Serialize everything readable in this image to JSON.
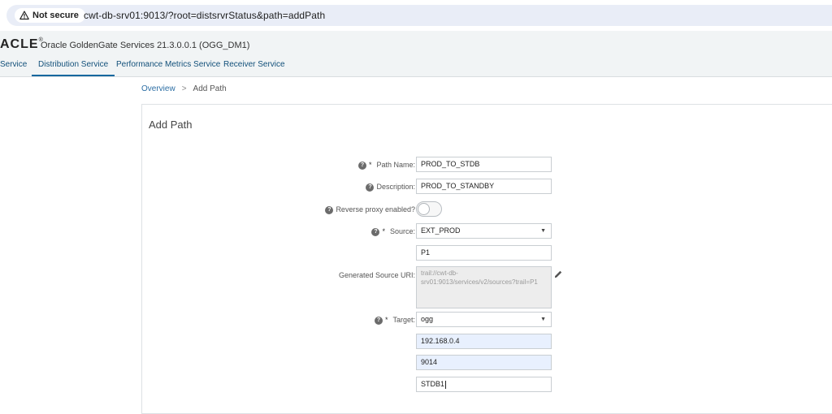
{
  "browser": {
    "security_label": "Not secure",
    "url": "cwt-db-srv01:9013/?root=distsrvrStatus&path=addPath"
  },
  "header": {
    "brand": "ACLE",
    "brand_mark": "®",
    "product": "Oracle GoldenGate Services 21.3.0.0.1 (OGG_DM1)",
    "tabs": [
      {
        "label": "Service",
        "active": false
      },
      {
        "label": "Distribution Service",
        "active": true
      },
      {
        "label": "Performance Metrics Service",
        "active": false
      },
      {
        "label": "Receiver Service",
        "active": false
      }
    ]
  },
  "breadcrumb": {
    "parent": "Overview",
    "separator": ">",
    "current": "Add Path"
  },
  "form": {
    "title": "Add Path",
    "path_name": {
      "label": "Path Name:",
      "value": "PROD_TO_STDB"
    },
    "description": {
      "label": "Description:",
      "value": "PROD_TO_STANDBY"
    },
    "reverse_proxy": {
      "label": "Reverse proxy enabled?",
      "enabled": false
    },
    "source": {
      "label": "Source:",
      "value": "EXT_PROD"
    },
    "source_trail": {
      "value": "P1"
    },
    "generated_uri": {
      "label": "Generated Source URI:",
      "value": "trail://cwt-db-srv01:9013/services/v2/sources?trail=P1"
    },
    "target": {
      "label": "Target:",
      "value": "ogg"
    },
    "target_host": {
      "value": "192.168.0.4"
    },
    "target_port": {
      "value": "9014"
    },
    "target_trail": {
      "value": "STDB1"
    }
  },
  "colors": {
    "accent": "#13689e",
    "link": "#2c6ea4",
    "header_bg": "#f1f4f5",
    "autofill_bg": "#e8f0fe"
  }
}
